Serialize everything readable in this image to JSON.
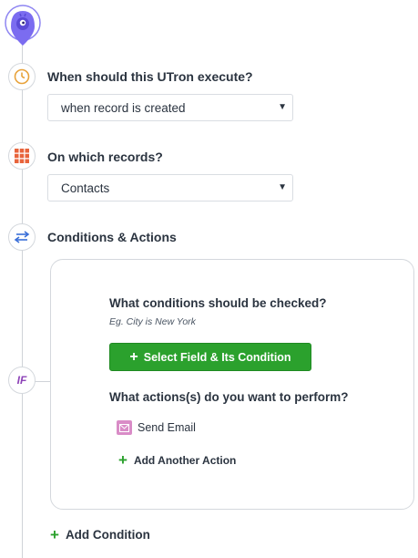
{
  "steps": {
    "trigger": {
      "title": "When should this UTron execute?",
      "selected": "when record is created",
      "icon": "clock-icon"
    },
    "records": {
      "title": "On which records?",
      "selected": "Contacts",
      "icon": "grid-icon"
    },
    "conditions_actions": {
      "title": "Conditions & Actions",
      "icon": "swap-arrows-icon"
    }
  },
  "condition_block": {
    "badge": "IF",
    "conditions_question": "What conditions should be checked?",
    "conditions_hint": "Eg. City is New York",
    "select_field_button": "Select Field & Its Condition",
    "actions_question": "What actions(s) do you want to perform?",
    "actions": [
      {
        "label": "Send Email",
        "icon": "mail-icon"
      }
    ],
    "add_action": "Add Another Action"
  },
  "add_condition": "Add Condition",
  "colors": {
    "accent_green": "#2ba12d",
    "pin_purple": "#7b6cf0",
    "clock_orange": "#e8a33c",
    "grid_orange": "#e8643c",
    "swap_blue": "#3a6fd8",
    "if_purple": "#8e44b8",
    "mail_pink": "#d98cc7"
  }
}
